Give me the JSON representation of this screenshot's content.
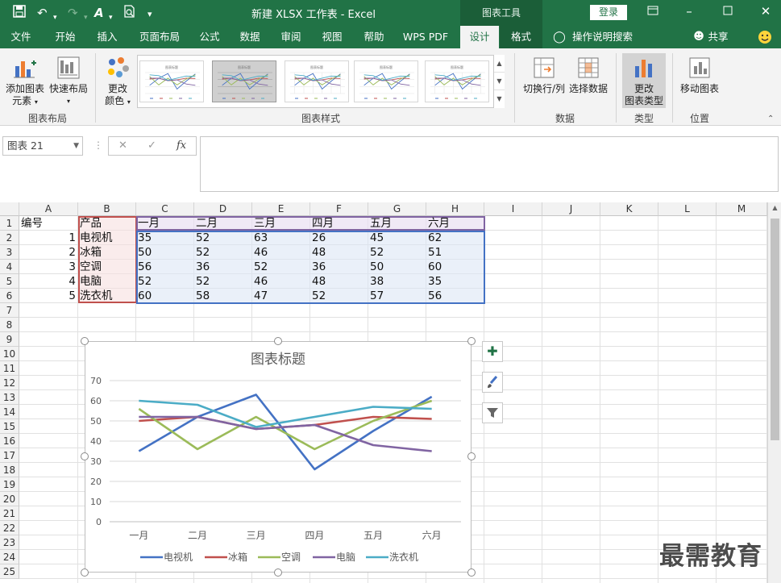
{
  "titlebar": {
    "document_title": "新建 XLSX 工作表  -  Excel",
    "context_group": "图表工具",
    "login_label": "登录"
  },
  "tabs": [
    "文件",
    "开始",
    "插入",
    "页面布局",
    "公式",
    "数据",
    "审阅",
    "视图",
    "帮助",
    "WPS PDF",
    "设计",
    "格式"
  ],
  "tell_me": "操作说明搜索",
  "share": "共享",
  "ribbon": {
    "add_element": [
      "添加图表",
      "元素"
    ],
    "quick_layout": "快速布局",
    "change_colors": [
      "更改",
      "颜色"
    ],
    "switch_row_col": "切换行/列",
    "select_data": "选择数据",
    "change_type": [
      "更改",
      "图表类型"
    ],
    "move_chart": "移动图表",
    "groups": {
      "layout": "图表布局",
      "styles": "图表样式",
      "data": "数据",
      "type": "类型",
      "location": "位置"
    },
    "thumb_title": "图表标题"
  },
  "namebox": "图表 21",
  "fx_label": "fx",
  "columns": [
    "A",
    "B",
    "C",
    "D",
    "E",
    "F",
    "G",
    "H",
    "I",
    "J",
    "K",
    "L",
    "M"
  ],
  "rows": [
    "1",
    "2",
    "3",
    "4",
    "5",
    "6",
    "7",
    "8",
    "9",
    "10",
    "11",
    "12",
    "13",
    "14",
    "15",
    "16",
    "17",
    "18",
    "19",
    "20",
    "21",
    "22",
    "23",
    "24",
    "25"
  ],
  "sheet": {
    "header": [
      "编号",
      "产品",
      "一月",
      "二月",
      "三月",
      "四月",
      "五月",
      "六月"
    ],
    "data": [
      [
        "1",
        "电视机",
        "35",
        "52",
        "63",
        "26",
        "45",
        "62"
      ],
      [
        "2",
        "冰箱",
        "50",
        "52",
        "46",
        "48",
        "52",
        "51"
      ],
      [
        "3",
        "空调",
        "56",
        "36",
        "52",
        "36",
        "50",
        "60"
      ],
      [
        "4",
        "电脑",
        "52",
        "52",
        "46",
        "48",
        "38",
        "35"
      ],
      [
        "5",
        "洗衣机",
        "60",
        "58",
        "47",
        "52",
        "57",
        "56"
      ]
    ]
  },
  "chart_data": {
    "type": "line",
    "title": "图表标题",
    "categories": [
      "一月",
      "二月",
      "三月",
      "四月",
      "五月",
      "六月"
    ],
    "ylim": [
      0,
      70
    ],
    "yticks": [
      0,
      10,
      20,
      30,
      40,
      50,
      60,
      70
    ],
    "grid": true,
    "legend": "bottom",
    "series": [
      {
        "name": "电视机",
        "values": [
          35,
          52,
          63,
          26,
          45,
          62
        ],
        "color": "#4472c4"
      },
      {
        "name": "冰箱",
        "values": [
          50,
          52,
          46,
          48,
          52,
          51
        ],
        "color": "#c0504d"
      },
      {
        "name": "空调",
        "values": [
          56,
          36,
          52,
          36,
          50,
          60
        ],
        "color": "#9bbb59"
      },
      {
        "name": "电脑",
        "values": [
          52,
          52,
          46,
          48,
          38,
          35
        ],
        "color": "#8064a2"
      },
      {
        "name": "洗衣机",
        "values": [
          60,
          58,
          47,
          52,
          57,
          56
        ],
        "color": "#4bacc6"
      }
    ]
  },
  "watermark": "最需教育"
}
